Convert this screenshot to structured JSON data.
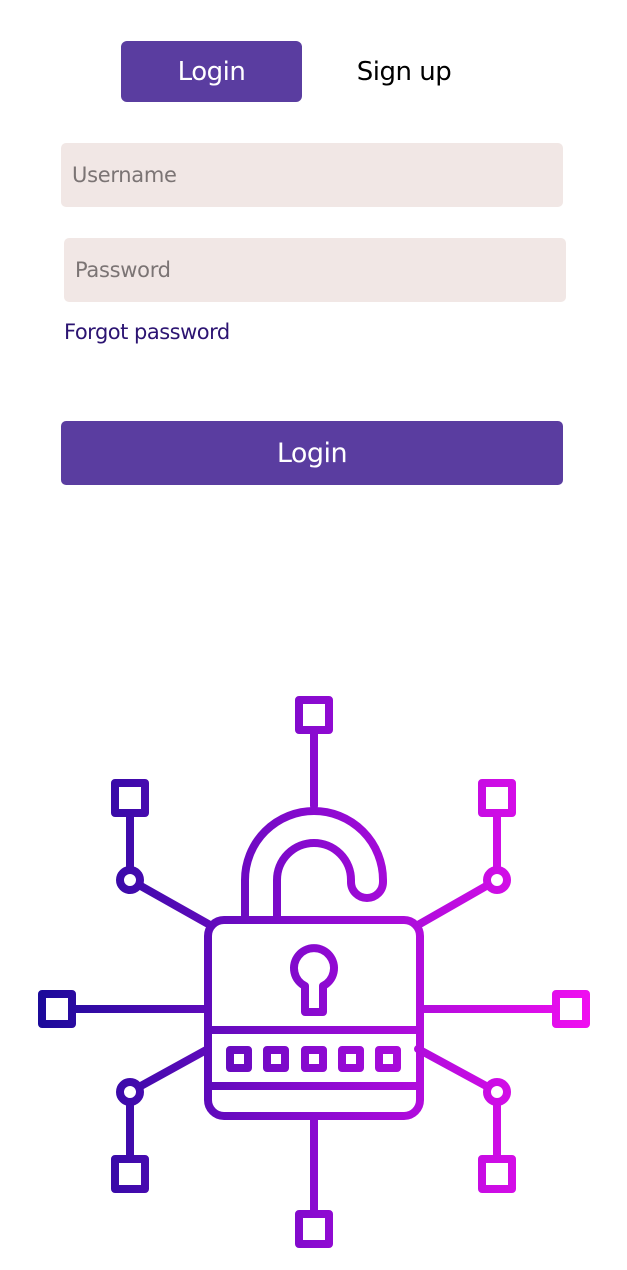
{
  "tabs": {
    "login_label": "Login",
    "signup_label": "Sign up"
  },
  "form": {
    "username_placeholder": "Username",
    "password_placeholder": "Password",
    "forgot_label": "Forgot password",
    "submit_label": "Login"
  },
  "colors": {
    "accent": "#5a3da0",
    "field_bg": "#f1e7e5",
    "link": "#2c1472",
    "gradient_start": "#1c0a9a",
    "gradient_end": "#f00ef0"
  },
  "illustration": {
    "icon": "network-unlocked-padlock-icon"
  }
}
